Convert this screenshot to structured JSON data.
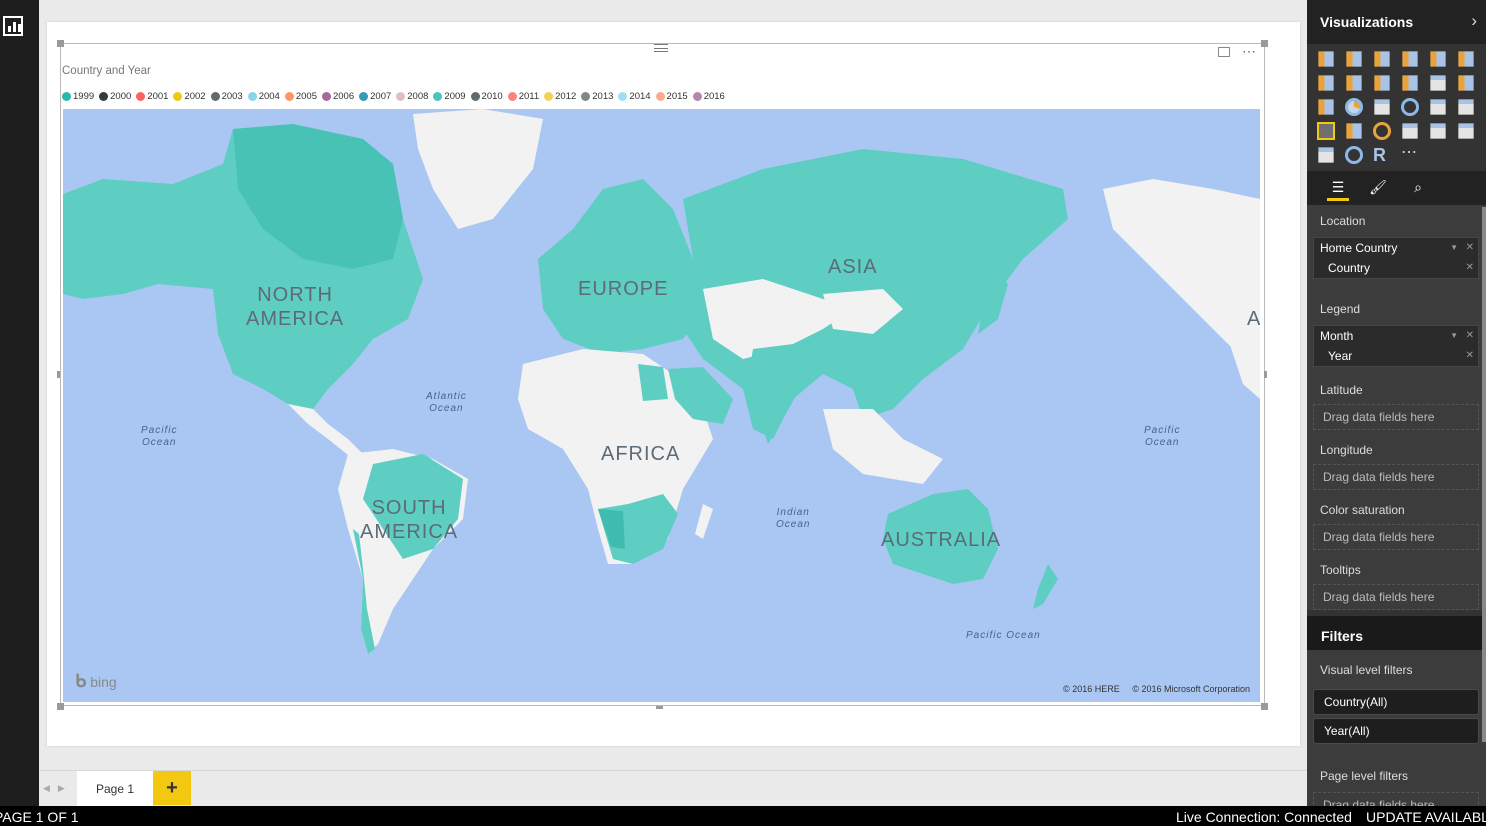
{
  "visual": {
    "title": "Country and Year",
    "legend": [
      {
        "label": "1999",
        "color": "#2ab7a9"
      },
      {
        "label": "2000",
        "color": "#333d40"
      },
      {
        "label": "2001",
        "color": "#fd625e"
      },
      {
        "label": "2002",
        "color": "#f2c80f"
      },
      {
        "label": "2003",
        "color": "#5f6b6d"
      },
      {
        "label": "2004",
        "color": "#8ad4eb"
      },
      {
        "label": "2005",
        "color": "#fe9666"
      },
      {
        "label": "2006",
        "color": "#a66999"
      },
      {
        "label": "2007",
        "color": "#3599b8"
      },
      {
        "label": "2008",
        "color": "#dfbfbf"
      },
      {
        "label": "2009",
        "color": "#4ac5bb"
      },
      {
        "label": "2010",
        "color": "#5f6b6d"
      },
      {
        "label": "2011",
        "color": "#fb8281"
      },
      {
        "label": "2012",
        "color": "#f4d25a"
      },
      {
        "label": "2013",
        "color": "#7f898a"
      },
      {
        "label": "2014",
        "color": "#a4ddee"
      },
      {
        "label": "2015",
        "color": "#fdab89"
      },
      {
        "label": "2016",
        "color": "#b687ac"
      }
    ],
    "map": {
      "continents": {
        "north_america": "NORTH\nAMERICA",
        "europe": "EUROPE",
        "asia": "ASIA",
        "africa": "AFRICA",
        "south_america": "SOUTH\nAMERICA",
        "australia": "AUSTRALIA",
        "edge_letter": "A"
      },
      "oceans": {
        "atlantic": "Atlantic\nOcean",
        "pacific_left": "Pacific\nOcean",
        "pacific_right": "Pacific\nOcean",
        "indian": "Indian\nOcean",
        "pacific_bottom": "Pacific Ocean"
      },
      "bing": "bing",
      "copyright_here": "© 2016 HERE",
      "copyright_ms": "© 2016 Microsoft Corporation",
      "colors": {
        "water": "#a9c7f2",
        "land": "#f2f2f2",
        "highlight": "#5ecec3",
        "highlight_dark": "#3fbcb0"
      }
    }
  },
  "tabs": {
    "page1": "Page 1",
    "add": "+"
  },
  "viz_pane": {
    "title": "Visualizations",
    "more_icon": "⋯",
    "r_icon": "R",
    "wells": {
      "location_label": "Location",
      "location_items": [
        "Home Country",
        "Country"
      ],
      "legend_label": "Legend",
      "legend_items": [
        "Month",
        "Year"
      ],
      "latitude_label": "Latitude",
      "longitude_label": "Longitude",
      "color_saturation_label": "Color saturation",
      "tooltips_label": "Tooltips",
      "drop_placeholder": "Drag data fields here"
    },
    "filters": {
      "title": "Filters",
      "visual_level": "Visual level filters",
      "pills": [
        "Country(All)",
        "Year(All)"
      ],
      "page_level": "Page level filters",
      "drop_placeholder": "Drag data fields here"
    }
  },
  "status": {
    "page": "PAGE 1 OF 1",
    "connection": "Live Connection: Connected",
    "update": "UPDATE AVAILABLE"
  }
}
